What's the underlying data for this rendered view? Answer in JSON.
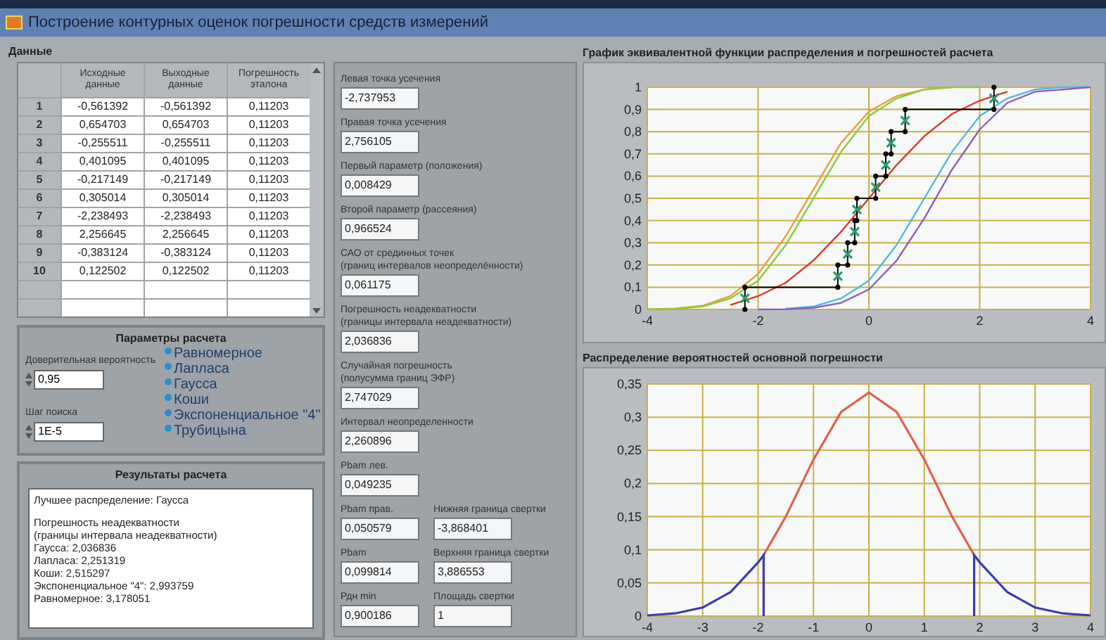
{
  "window": {
    "title": "Построение контурных оценок погрешности средств измерений"
  },
  "data_panel": {
    "label": "Данные",
    "table": {
      "columns": [
        "Исходные данные",
        "Выходные данные",
        "Погрешность эталона"
      ],
      "rows": [
        {
          "index": "1",
          "cells": [
            "-0,561392",
            "-0,561392",
            "0,11203"
          ]
        },
        {
          "index": "2",
          "cells": [
            "0,654703",
            "0,654703",
            "0,11203"
          ]
        },
        {
          "index": "3",
          "cells": [
            "-0,255511",
            "-0,255511",
            "0,11203"
          ]
        },
        {
          "index": "4",
          "cells": [
            "0,401095",
            "0,401095",
            "0,11203"
          ]
        },
        {
          "index": "5",
          "cells": [
            "-0,217149",
            "-0,217149",
            "0,11203"
          ]
        },
        {
          "index": "6",
          "cells": [
            "0,305014",
            "0,305014",
            "0,11203"
          ]
        },
        {
          "index": "7",
          "cells": [
            "-2,238493",
            "-2,238493",
            "0,11203"
          ]
        },
        {
          "index": "8",
          "cells": [
            "2,256645",
            "2,256645",
            "0,11203"
          ]
        },
        {
          "index": "9",
          "cells": [
            "-0,383124",
            "-0,383124",
            "0,11203"
          ]
        },
        {
          "index": "10",
          "cells": [
            "0,122502",
            "0,122502",
            "0,11203"
          ]
        }
      ]
    }
  },
  "parameters": {
    "title": "Параметры расчета",
    "fields": [
      {
        "label": "Доверительная вероятность",
        "value": "0,95"
      },
      {
        "label": "Шаг поиска",
        "value": "1E-5"
      }
    ],
    "distributions": [
      "Равномерное",
      "Лапласа",
      "Гаусса",
      "Коши",
      "Экспоненциальное \"4\"",
      "Трубицына"
    ]
  },
  "results": {
    "title": "Результаты расчета",
    "paragraphs": [
      [
        "Лучшее распределение: Гаусса"
      ],
      [
        "Погрешность неадекватности",
        "(границы интервала неадекватности)",
        "Гаусса: 2,036836",
        "Лапласа: 2,251319",
        "Коши: 2,515297",
        "Экспоненциальное \"4\": 2,993759",
        "Равномерное: 3,178051"
      ]
    ]
  },
  "outputs": [
    {
      "items": [
        {
          "label": "Левая точка усечения",
          "value": "-2,737953"
        }
      ]
    },
    {
      "items": [
        {
          "label": "Правая точка усечения",
          "value": "2,756105"
        }
      ]
    },
    {
      "items": [
        {
          "label": "Первый параметр (положения)",
          "value": "0,008429"
        }
      ]
    },
    {
      "items": [
        {
          "label": "Второй параметр (рассеяния)",
          "value": "0,966524"
        }
      ]
    },
    {
      "items": [
        {
          "label": "САО от срединных точек\n(границ интервалов неопределённости)",
          "value": "0,061175"
        }
      ]
    },
    {
      "items": [
        {
          "label": "Погрешность неадекватности\n(границы интервала неадекватности)",
          "value": "2,036836"
        }
      ]
    },
    {
      "items": [
        {
          "label": "Случайная погрешность\n(полусумма границ ЭФР)",
          "value": "2,747029"
        }
      ]
    },
    {
      "items": [
        {
          "label": "Интервал неопределенности",
          "value": "2,260896"
        }
      ]
    },
    {
      "items": [
        {
          "label": "Pbam лев.",
          "value": "0,049235"
        }
      ]
    },
    {
      "items": [
        {
          "label": "Pbam прав.",
          "value": "0,050579"
        },
        {
          "label": "Нижняя граница свертки",
          "value": "-3,868401"
        }
      ]
    },
    {
      "items": [
        {
          "label": "Pbam",
          "value": "0,099814"
        },
        {
          "label": "Верхняя граница свертки",
          "value": "3,886553"
        }
      ]
    },
    {
      "items": [
        {
          "label": "Рдн min",
          "value": "0,900186"
        },
        {
          "label": "Площадь свертки",
          "value": "1"
        }
      ]
    }
  ],
  "charts": [
    {
      "title": "График эквивалентной функции распределения и погрешностей расчета",
      "chart_data": {
        "type": "line",
        "x": [
          -4,
          -3.5,
          -3,
          -2.5,
          -2,
          -1.5,
          -1,
          -0.5,
          0,
          0.5,
          1,
          1.5,
          2,
          2.5,
          3,
          3.5,
          4
        ],
        "xlim": [
          -4,
          4
        ],
        "ylim": [
          0,
          1
        ],
        "xticks": [
          -4,
          -2,
          0,
          2,
          4
        ],
        "grid": true,
        "yticks": [
          {
            "value": 0,
            "label": "0"
          },
          {
            "value": 0.1,
            "label": "0,1"
          },
          {
            "value": 0.2,
            "label": "0,2"
          },
          {
            "value": 0.3,
            "label": "0,3"
          },
          {
            "value": 0.4,
            "label": "0,4"
          },
          {
            "value": 0.5,
            "label": "0,5"
          },
          {
            "value": 0.6,
            "label": "0,6"
          },
          {
            "value": 0.7,
            "label": "0,7"
          },
          {
            "value": 0.8,
            "label": "0,8"
          },
          {
            "value": 0.9,
            "label": "0,9"
          },
          {
            "value": 1,
            "label": "1"
          }
        ],
        "series": [
          {
            "color": "#e8a030",
            "values": [
              0.001,
              0.004,
              0.017,
              0.06,
              0.16,
              0.33,
              0.54,
              0.75,
              0.89,
              0.96,
              0.99,
              1,
              null,
              null,
              null,
              null,
              null
            ]
          },
          {
            "color": "#8cc840",
            "values": [
              0,
              0.003,
              0.013,
              0.05,
              0.13,
              0.29,
              0.5,
              0.71,
              0.87,
              0.95,
              0.99,
              1,
              1,
              null,
              null,
              null,
              null
            ]
          },
          {
            "color": "#d83a2a",
            "values": [
              null,
              null,
              null,
              0.02,
              0.06,
              0.12,
              0.22,
              0.35,
              0.5,
              0.65,
              0.78,
              0.88,
              0.94,
              0.98,
              null,
              null,
              null
            ]
          },
          {
            "color": "#50b8e0",
            "values": [
              null,
              null,
              null,
              null,
              null,
              0.003,
              0.013,
              0.05,
              0.13,
              0.29,
              0.5,
              0.71,
              0.87,
              0.95,
              0.99,
              1,
              1
            ]
          },
          {
            "color": "#8a60c0",
            "values": [
              null,
              null,
              null,
              null,
              0,
              0.001,
              0.007,
              0.03,
              0.09,
              0.22,
              0.41,
              0.63,
              0.81,
              0.93,
              0.98,
              0.99,
              1
            ]
          },
          {
            "marker": "dot",
            "color": "#000000",
            "x": [
              -2.238,
              -2.238,
              -0.561,
              -0.561,
              -0.383,
              -0.383,
              -0.256,
              -0.256,
              -0.217,
              -0.217,
              0.123,
              0.123,
              0.305,
              0.305,
              0.401,
              0.401,
              0.655,
              0.655,
              2.257,
              2.257
            ],
            "values": [
              0,
              0.1,
              0.1,
              0.2,
              0.2,
              0.3,
              0.3,
              0.4,
              0.4,
              0.5,
              0.5,
              0.6,
              0.6,
              0.7,
              0.7,
              0.8,
              0.8,
              0.9,
              0.9,
              1
            ]
          },
          {
            "type": "scatter",
            "marker": "cross",
            "color": "#2e9b6e",
            "x": [
              -2.238,
              -0.561,
              -0.383,
              -0.256,
              -0.217,
              0.123,
              0.305,
              0.401,
              0.655,
              2.257
            ],
            "values": [
              0.05,
              0.15,
              0.25,
              0.35,
              0.45,
              0.55,
              0.65,
              0.75,
              0.85,
              0.95
            ]
          }
        ]
      }
    },
    {
      "title": "Распределение вероятностей основной погрешности",
      "chart_data": {
        "type": "line",
        "x": [
          -4,
          -3.5,
          -3,
          -2.5,
          -2,
          -1.9,
          -1.9,
          -1.5,
          -1,
          -0.5,
          0,
          0.5,
          1,
          1.5,
          1.9,
          1.9,
          2,
          2.5,
          3,
          3.5,
          4
        ],
        "xlim": [
          -4,
          4
        ],
        "ylim": [
          0,
          0.35
        ],
        "xticks": [
          -4,
          -3,
          -2,
          -1,
          0,
          1,
          2,
          3,
          4
        ],
        "grid": true,
        "yticks": [
          {
            "value": 0,
            "label": "0"
          },
          {
            "value": 0.05,
            "label": "0,05"
          },
          {
            "value": 0.1,
            "label": "0,1"
          },
          {
            "value": 0.15,
            "label": "0,15"
          },
          {
            "value": 0.2,
            "label": "0,2"
          },
          {
            "value": 0.25,
            "label": "0,25"
          },
          {
            "value": 0.3,
            "label": "0,3"
          },
          {
            "value": 0.35,
            "label": "0,35"
          }
        ],
        "series": [
          {
            "color": "#e0604a",
            "values": [
              null,
              null,
              null,
              null,
              null,
              null,
              0.092,
              0.15,
              0.236,
              0.308,
              0.337,
              0.308,
              0.236,
              0.15,
              0.092,
              null,
              null,
              null,
              null,
              null,
              null
            ]
          },
          {
            "color": "#3a3cb0",
            "values": [
              0.001,
              0.004,
              0.013,
              0.036,
              0.081,
              0.092,
              0,
              null,
              null,
              null,
              null,
              null,
              null,
              null,
              0,
              0.092,
              0.081,
              0.036,
              0.013,
              0.004,
              0.001
            ]
          }
        ]
      }
    }
  ]
}
